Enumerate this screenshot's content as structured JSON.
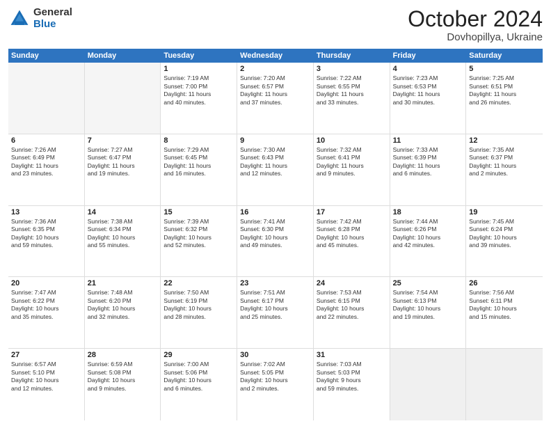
{
  "logo": {
    "general": "General",
    "blue": "Blue"
  },
  "header": {
    "month": "October 2024",
    "location": "Dovhopillya, Ukraine"
  },
  "weekdays": [
    "Sunday",
    "Monday",
    "Tuesday",
    "Wednesday",
    "Thursday",
    "Friday",
    "Saturday"
  ],
  "weeks": [
    [
      {
        "day": "",
        "empty": true
      },
      {
        "day": "",
        "empty": true
      },
      {
        "day": "1",
        "line1": "Sunrise: 7:19 AM",
        "line2": "Sunset: 7:00 PM",
        "line3": "Daylight: 11 hours",
        "line4": "and 40 minutes."
      },
      {
        "day": "2",
        "line1": "Sunrise: 7:20 AM",
        "line2": "Sunset: 6:57 PM",
        "line3": "Daylight: 11 hours",
        "line4": "and 37 minutes."
      },
      {
        "day": "3",
        "line1": "Sunrise: 7:22 AM",
        "line2": "Sunset: 6:55 PM",
        "line3": "Daylight: 11 hours",
        "line4": "and 33 minutes."
      },
      {
        "day": "4",
        "line1": "Sunrise: 7:23 AM",
        "line2": "Sunset: 6:53 PM",
        "line3": "Daylight: 11 hours",
        "line4": "and 30 minutes."
      },
      {
        "day": "5",
        "line1": "Sunrise: 7:25 AM",
        "line2": "Sunset: 6:51 PM",
        "line3": "Daylight: 11 hours",
        "line4": "and 26 minutes."
      }
    ],
    [
      {
        "day": "6",
        "line1": "Sunrise: 7:26 AM",
        "line2": "Sunset: 6:49 PM",
        "line3": "Daylight: 11 hours",
        "line4": "and 23 minutes."
      },
      {
        "day": "7",
        "line1": "Sunrise: 7:27 AM",
        "line2": "Sunset: 6:47 PM",
        "line3": "Daylight: 11 hours",
        "line4": "and 19 minutes."
      },
      {
        "day": "8",
        "line1": "Sunrise: 7:29 AM",
        "line2": "Sunset: 6:45 PM",
        "line3": "Daylight: 11 hours",
        "line4": "and 16 minutes."
      },
      {
        "day": "9",
        "line1": "Sunrise: 7:30 AM",
        "line2": "Sunset: 6:43 PM",
        "line3": "Daylight: 11 hours",
        "line4": "and 12 minutes."
      },
      {
        "day": "10",
        "line1": "Sunrise: 7:32 AM",
        "line2": "Sunset: 6:41 PM",
        "line3": "Daylight: 11 hours",
        "line4": "and 9 minutes."
      },
      {
        "day": "11",
        "line1": "Sunrise: 7:33 AM",
        "line2": "Sunset: 6:39 PM",
        "line3": "Daylight: 11 hours",
        "line4": "and 6 minutes."
      },
      {
        "day": "12",
        "line1": "Sunrise: 7:35 AM",
        "line2": "Sunset: 6:37 PM",
        "line3": "Daylight: 11 hours",
        "line4": "and 2 minutes."
      }
    ],
    [
      {
        "day": "13",
        "line1": "Sunrise: 7:36 AM",
        "line2": "Sunset: 6:35 PM",
        "line3": "Daylight: 10 hours",
        "line4": "and 59 minutes."
      },
      {
        "day": "14",
        "line1": "Sunrise: 7:38 AM",
        "line2": "Sunset: 6:34 PM",
        "line3": "Daylight: 10 hours",
        "line4": "and 55 minutes."
      },
      {
        "day": "15",
        "line1": "Sunrise: 7:39 AM",
        "line2": "Sunset: 6:32 PM",
        "line3": "Daylight: 10 hours",
        "line4": "and 52 minutes."
      },
      {
        "day": "16",
        "line1": "Sunrise: 7:41 AM",
        "line2": "Sunset: 6:30 PM",
        "line3": "Daylight: 10 hours",
        "line4": "and 49 minutes."
      },
      {
        "day": "17",
        "line1": "Sunrise: 7:42 AM",
        "line2": "Sunset: 6:28 PM",
        "line3": "Daylight: 10 hours",
        "line4": "and 45 minutes."
      },
      {
        "day": "18",
        "line1": "Sunrise: 7:44 AM",
        "line2": "Sunset: 6:26 PM",
        "line3": "Daylight: 10 hours",
        "line4": "and 42 minutes."
      },
      {
        "day": "19",
        "line1": "Sunrise: 7:45 AM",
        "line2": "Sunset: 6:24 PM",
        "line3": "Daylight: 10 hours",
        "line4": "and 39 minutes."
      }
    ],
    [
      {
        "day": "20",
        "line1": "Sunrise: 7:47 AM",
        "line2": "Sunset: 6:22 PM",
        "line3": "Daylight: 10 hours",
        "line4": "and 35 minutes."
      },
      {
        "day": "21",
        "line1": "Sunrise: 7:48 AM",
        "line2": "Sunset: 6:20 PM",
        "line3": "Daylight: 10 hours",
        "line4": "and 32 minutes."
      },
      {
        "day": "22",
        "line1": "Sunrise: 7:50 AM",
        "line2": "Sunset: 6:19 PM",
        "line3": "Daylight: 10 hours",
        "line4": "and 28 minutes."
      },
      {
        "day": "23",
        "line1": "Sunrise: 7:51 AM",
        "line2": "Sunset: 6:17 PM",
        "line3": "Daylight: 10 hours",
        "line4": "and 25 minutes."
      },
      {
        "day": "24",
        "line1": "Sunrise: 7:53 AM",
        "line2": "Sunset: 6:15 PM",
        "line3": "Daylight: 10 hours",
        "line4": "and 22 minutes."
      },
      {
        "day": "25",
        "line1": "Sunrise: 7:54 AM",
        "line2": "Sunset: 6:13 PM",
        "line3": "Daylight: 10 hours",
        "line4": "and 19 minutes."
      },
      {
        "day": "26",
        "line1": "Sunrise: 7:56 AM",
        "line2": "Sunset: 6:11 PM",
        "line3": "Daylight: 10 hours",
        "line4": "and 15 minutes."
      }
    ],
    [
      {
        "day": "27",
        "line1": "Sunrise: 6:57 AM",
        "line2": "Sunset: 5:10 PM",
        "line3": "Daylight: 10 hours",
        "line4": "and 12 minutes."
      },
      {
        "day": "28",
        "line1": "Sunrise: 6:59 AM",
        "line2": "Sunset: 5:08 PM",
        "line3": "Daylight: 10 hours",
        "line4": "and 9 minutes."
      },
      {
        "day": "29",
        "line1": "Sunrise: 7:00 AM",
        "line2": "Sunset: 5:06 PM",
        "line3": "Daylight: 10 hours",
        "line4": "and 6 minutes."
      },
      {
        "day": "30",
        "line1": "Sunrise: 7:02 AM",
        "line2": "Sunset: 5:05 PM",
        "line3": "Daylight: 10 hours",
        "line4": "and 2 minutes."
      },
      {
        "day": "31",
        "line1": "Sunrise: 7:03 AM",
        "line2": "Sunset: 5:03 PM",
        "line3": "Daylight: 9 hours",
        "line4": "and 59 minutes."
      },
      {
        "day": "",
        "empty": true,
        "shaded": true
      },
      {
        "day": "",
        "empty": true,
        "shaded": true
      }
    ]
  ]
}
